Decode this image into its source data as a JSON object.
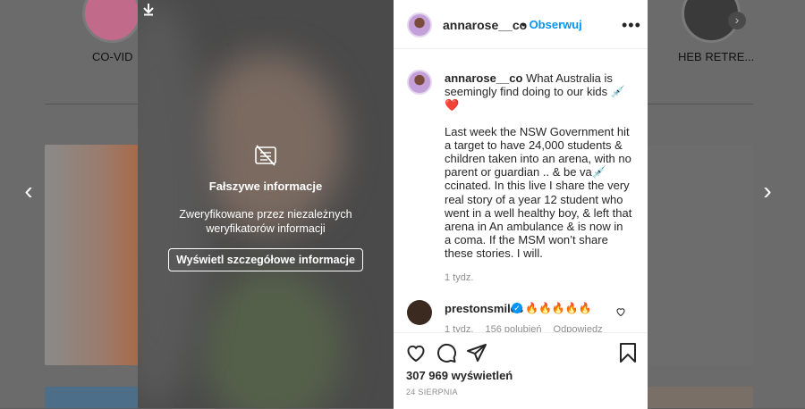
{
  "stories": [
    {
      "label": "CO-VID"
    },
    {
      "label": "HEB RETRE..."
    }
  ],
  "media": {
    "fake_info": {
      "title": "Fałszywe informacje",
      "description": "Zweryfikowane przez niezależnych weryfikatorów informacji",
      "button_label": "Wyświetl szczegółowe informacje"
    }
  },
  "post": {
    "username": "annarose__co",
    "follow_label": "Obserwuj",
    "more_label": "•••",
    "caption_username": "annarose__co",
    "caption_first": "What Australia is seemingly find doing to our kids 💉",
    "caption_heart": "❤️",
    "caption_body": "Last week the NSW Government hit a target to have 24,000 students & children taken into an arena, with no parent or guardian .. & be va💉ccinated. In this live I share the very real story of a year 12 student who went in a well healthy boy, & left that arena in An ambulance & is now in a coma. If the MSM won’t share these stories. I will.",
    "caption_time": "1 tydz.",
    "comment": {
      "username": "prestonsmiles",
      "text": "🔥🔥🔥🔥🔥",
      "time": "1 tydz.",
      "likes": "156 polubień",
      "reply": "Odpowiedz"
    },
    "views": "307 969 wyświetleń",
    "date": "24 SIERPNIA"
  },
  "colors": {
    "link_blue": "#0095f6",
    "text": "#262626",
    "muted": "#8e8e8e"
  }
}
